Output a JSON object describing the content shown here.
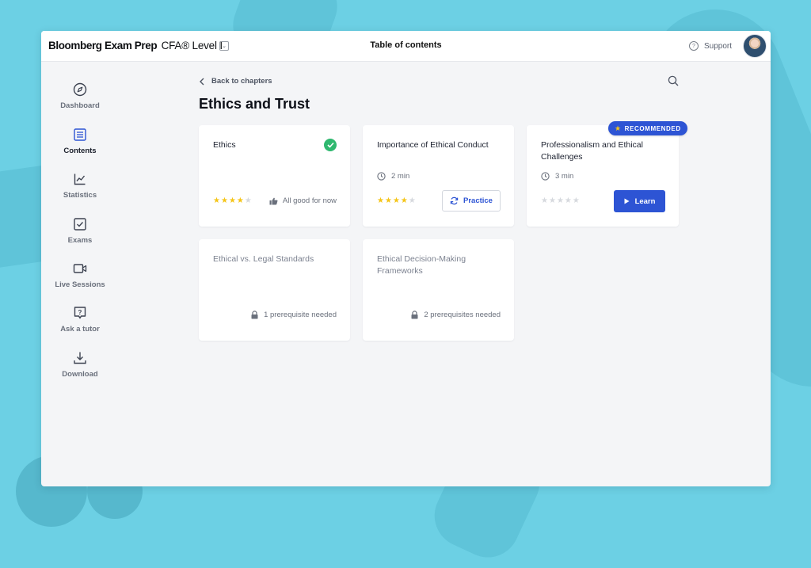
{
  "header": {
    "brand": "Bloomberg Exam Prep",
    "course": "CFA® Level I",
    "dropdown_icon": "chevron-down-icon",
    "title": "Table of contents",
    "support_label": "Support"
  },
  "sidebar": {
    "items": [
      {
        "label": "Dashboard",
        "icon": "compass-icon",
        "active": false
      },
      {
        "label": "Contents",
        "icon": "list-icon",
        "active": true
      },
      {
        "label": "Statistics",
        "icon": "line-chart-icon",
        "active": false
      },
      {
        "label": "Exams",
        "icon": "checkbox-icon",
        "active": false
      },
      {
        "label": "Live Sessions",
        "icon": "video-icon",
        "active": false
      },
      {
        "label": "Ask a tutor",
        "icon": "question-bubble-icon",
        "active": false
      },
      {
        "label": "Download",
        "icon": "download-icon",
        "active": false
      }
    ]
  },
  "main": {
    "back_label": "Back to chapters",
    "chapter_title": "Ethics and Trust",
    "recommended_badge": "RECOMMENDED",
    "cards": [
      {
        "title": "Ethics",
        "completed": true,
        "rating": 4,
        "max_rating": 5,
        "status": "All good for now"
      },
      {
        "title": "Importance of Ethical Conduct",
        "time": "2 min",
        "rating": 4,
        "max_rating": 5,
        "action": "Practice"
      },
      {
        "title": "Professionalism and Ethical Challenges",
        "time": "3 min",
        "rating": 0,
        "max_rating": 5,
        "action": "Learn",
        "recommended": true
      },
      {
        "title": "Ethical vs. Legal Standards",
        "locked": true,
        "prereq": "1 prerequisite needed"
      },
      {
        "title": "Ethical Decision-Making Frameworks",
        "locked": true,
        "prereq": "2 prerequisites needed"
      }
    ]
  },
  "colors": {
    "background": "#6cd0e4",
    "accent": "#2d54d4",
    "success": "#2fb86f",
    "star": "#f5c518"
  }
}
